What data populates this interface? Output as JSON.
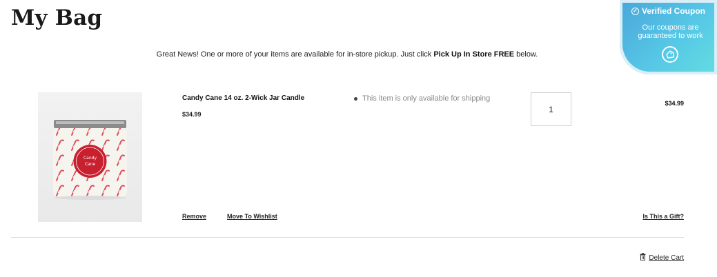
{
  "page": {
    "title": "My Bag"
  },
  "notice": {
    "text_before": "Great News! One or more of your items are available for in-store pickup. Just click ",
    "highlight": "Pick Up In Store FREE",
    "text_after": " below."
  },
  "coupon": {
    "title": "Verified Coupon",
    "subtitle": "Our coupons are guaranteed to work",
    "icon": "check-circle-icon",
    "logo_icon": "coupon-logo-icon"
  },
  "cart": {
    "items": [
      {
        "name": "Candy Cane 14 oz. 2-Wick Jar Candle",
        "price": "$34.99",
        "shipping_note": "This item is only available for shipping",
        "quantity": "1",
        "line_total": "$34.99",
        "image_label_top": "Candy",
        "image_label_bottom": "Cane",
        "remove_label": "Remove",
        "wishlist_label": "Move To Wishlist",
        "gift_label": "Is This a Gift?"
      }
    ],
    "delete_label": "Delete Cart",
    "delete_icon": "trash-icon"
  },
  "colors": {
    "badge_start": "#4aa6d9",
    "badge_end": "#63dde0",
    "candle_red": "#c8202f"
  }
}
